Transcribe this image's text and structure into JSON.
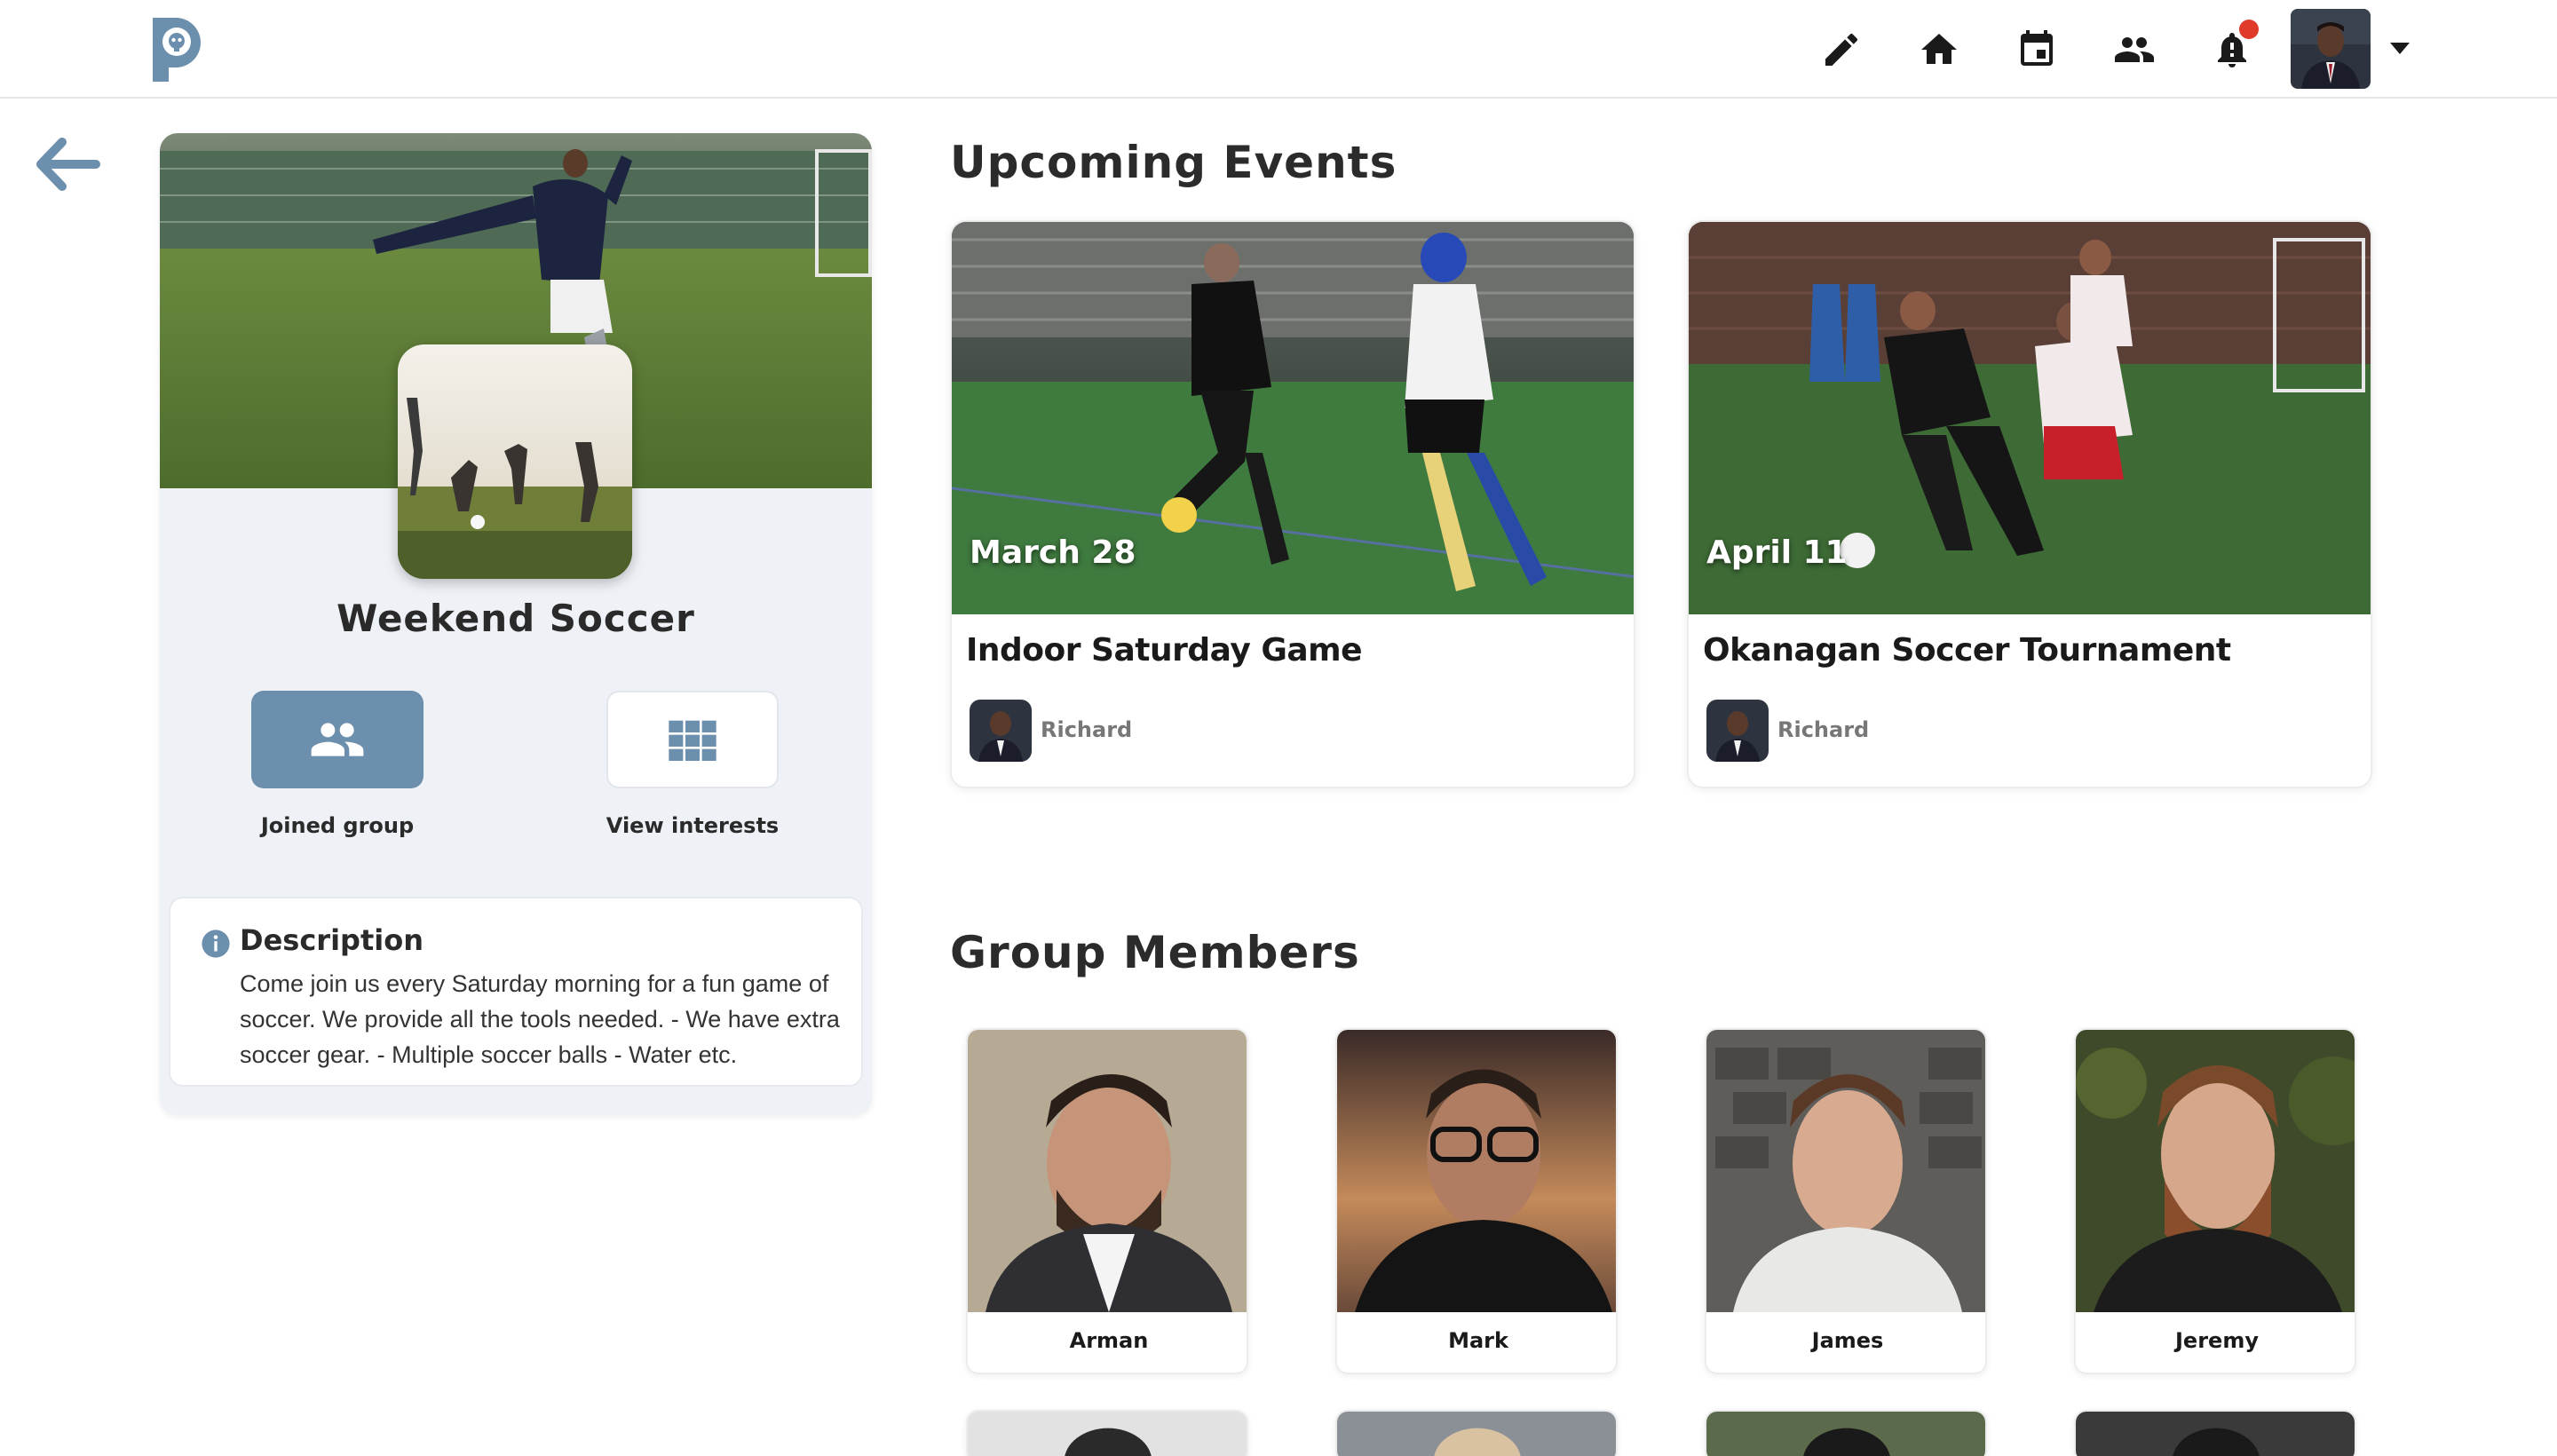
{
  "nav": {
    "icons": [
      "pencil-icon",
      "home-icon",
      "calendar-icon",
      "people-icon",
      "bell-icon"
    ],
    "notification_dot_color": "#e03b2a",
    "logo": "p"
  },
  "group": {
    "name": "Weekend Soccer",
    "actions": {
      "joined_label": "Joined group",
      "interests_label": "View interests"
    },
    "description": {
      "title": "Description",
      "text": "Come join us every Saturday morning for a fun game of soccer. We provide all the tools needed. - We have extra soccer gear. - Multiple soccer balls - Water etc."
    }
  },
  "events_section": {
    "title": "Upcoming Events",
    "events": [
      {
        "date": "March 28",
        "title": "Indoor Saturday Game",
        "host": "Richard"
      },
      {
        "date": "April 11",
        "title": "Okanagan Soccer Tournament",
        "host": "Richard"
      }
    ]
  },
  "members_section": {
    "title": "Group Members",
    "members": [
      {
        "name": "Arman"
      },
      {
        "name": "Mark"
      },
      {
        "name": "James"
      },
      {
        "name": "Jeremy"
      }
    ]
  },
  "colors": {
    "accent": "#6b8fad",
    "card_bg": "#eef1f6"
  }
}
